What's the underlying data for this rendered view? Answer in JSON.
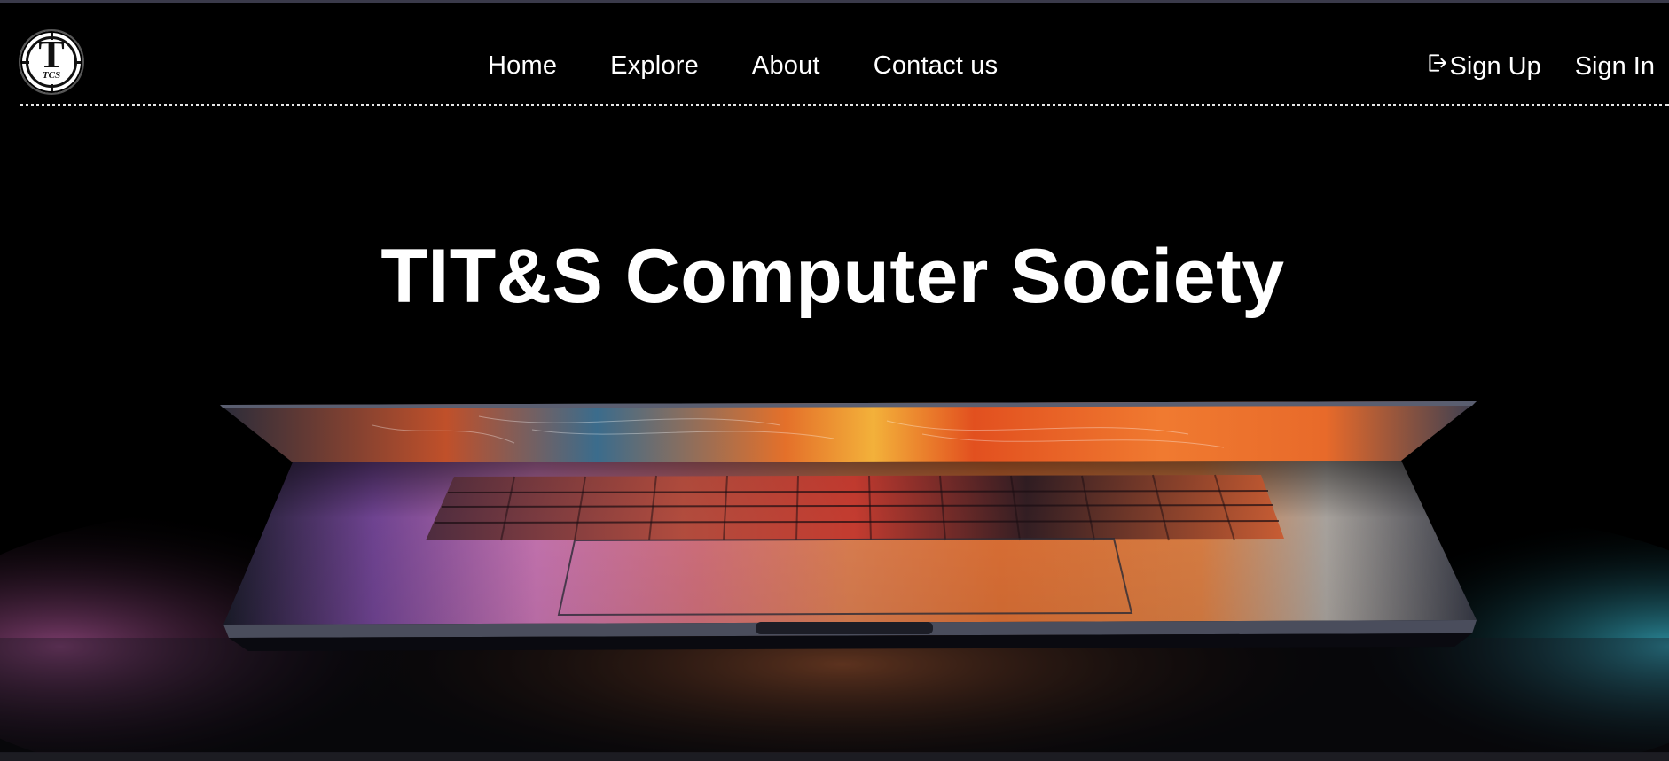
{
  "nav": {
    "logo_letter": "T",
    "logo_sub": "TCS",
    "links": [
      "Home",
      "Explore",
      "About",
      "Contact us"
    ],
    "signup_label": "Sign Up",
    "signin_label": "Sign In"
  },
  "hero": {
    "title": "TIT&S Computer Society"
  },
  "colors": {
    "background": "#000000",
    "text": "#ffffff",
    "divider": "#e6e6e6"
  }
}
